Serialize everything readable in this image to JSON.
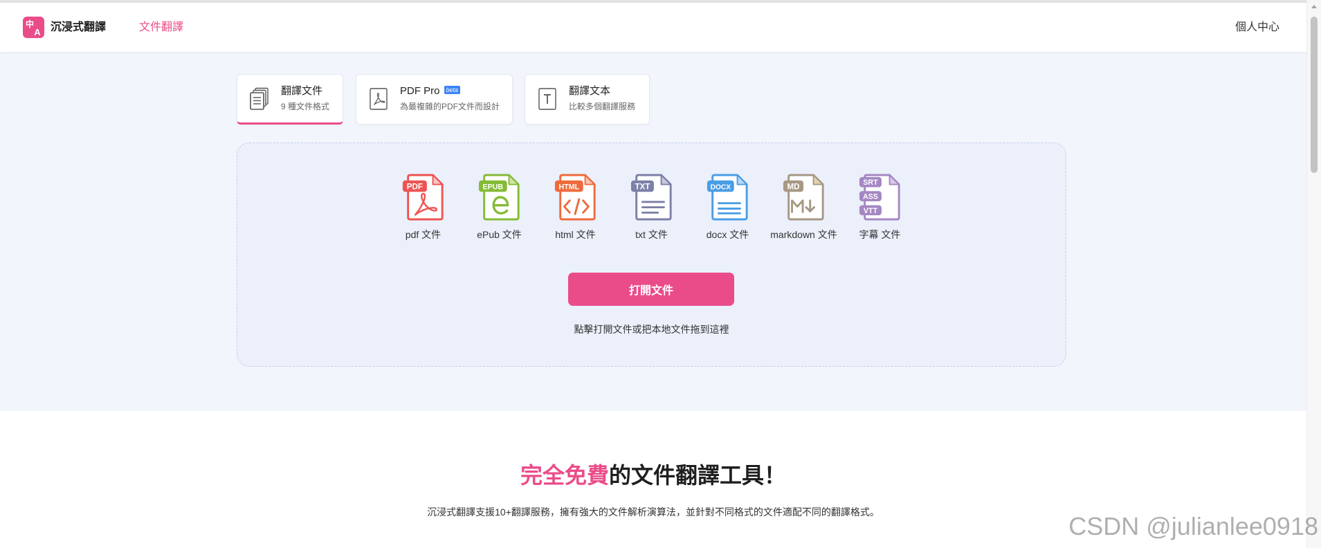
{
  "header": {
    "logo": {
      "glyph_top": "中",
      "glyph_bottom": "A"
    },
    "app_name": "沉浸式翻譯",
    "nav_active": "文件翻譯",
    "user_center": "個人中心"
  },
  "tabs": [
    {
      "title": "翻譯文件",
      "subtitle": "9 種文件格式",
      "icon": "document-stack-icon",
      "active": true
    },
    {
      "title": "PDF Pro",
      "badge": "beta",
      "subtitle": "為最複雜的PDF文件而設計",
      "icon": "pdf-icon",
      "active": false
    },
    {
      "title": "翻譯文本",
      "subtitle": "比較多個翻譯服務",
      "icon": "text-icon",
      "active": false
    }
  ],
  "upload": {
    "file_types": [
      {
        "label": "pdf 文件",
        "badges": [
          "PDF"
        ],
        "icon": "pdf-file-icon",
        "color": "#ee5352",
        "fold_color": "#f8c6c6"
      },
      {
        "label": "ePub 文件",
        "badges": [
          "EPUB"
        ],
        "icon": "epub-file-icon",
        "color": "#84bb35",
        "fold_color": "#d0e6a6"
      },
      {
        "label": "html 文件",
        "badges": [
          "HTML"
        ],
        "icon": "html-file-icon",
        "color": "#ef6a3b",
        "fold_color": "#f8c6b0"
      },
      {
        "label": "txt 文件",
        "badges": [
          "TXT"
        ],
        "icon": "txt-file-icon",
        "color": "#7d80a7",
        "fold_color": "#c7c9de"
      },
      {
        "label": "docx 文件",
        "badges": [
          "DOCX"
        ],
        "icon": "docx-file-icon",
        "color": "#4a9de5",
        "fold_color": "#badaf5"
      },
      {
        "label": "markdown 文件",
        "badges": [
          "MD"
        ],
        "icon": "markdown-file-icon",
        "color": "#a69884",
        "fold_color": "#e4d3ae"
      },
      {
        "label": "字幕 文件",
        "badges": [
          "SRT",
          "ASS",
          "VTT"
        ],
        "icon": "subtitle-file-icon",
        "color": "#a487c3",
        "fold_color": "#d9c8ea"
      }
    ],
    "open_button": "打開文件",
    "hint": "點擊打開文件或把本地文件拖到這裡"
  },
  "promo": {
    "headline_highlight": "完全免費",
    "headline_rest": "的文件翻譯工具！",
    "description": "沉浸式翻譯支援10+翻譯服務，擁有強大的文件解析演算法，並針對不同格式的文件適配不同的翻譯格式。"
  },
  "colors": {
    "accent": "#ea4c89",
    "main_bg": "#f3f5fc",
    "dropzone_bg": "#ebf0fb",
    "beta_badge": "#3b82f6"
  },
  "watermark": "CSDN @julianlee0918"
}
